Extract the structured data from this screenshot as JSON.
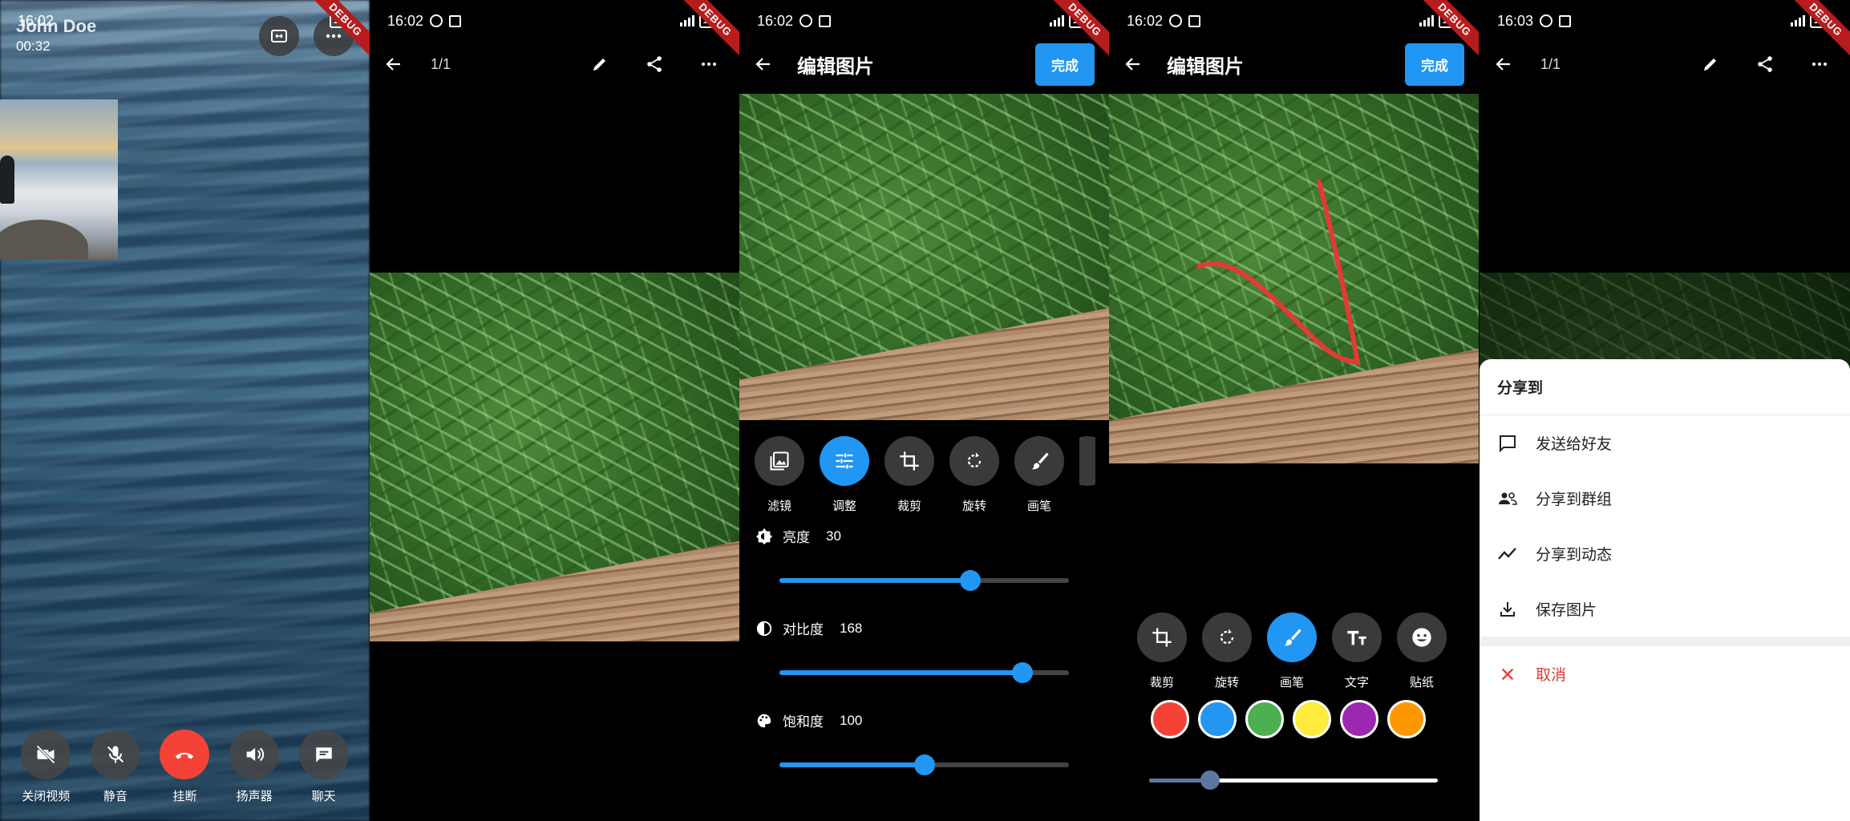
{
  "status": {
    "time_p1": "16:02",
    "time_p2": "16:02",
    "time_p3": "16:02",
    "time_p4": "16:02",
    "time_p5": "16:03",
    "battery": "100",
    "debug": "DEBUG"
  },
  "call": {
    "caller": "John Doe",
    "timer": "00:32",
    "controls": [
      {
        "label": "关闭视频",
        "icon": "videocam-off-icon"
      },
      {
        "label": "静音",
        "icon": "mic-off-icon"
      },
      {
        "label": "挂断",
        "icon": "hangup-icon"
      },
      {
        "label": "扬声器",
        "icon": "speaker-icon"
      },
      {
        "label": "聊天",
        "icon": "chat-icon"
      }
    ]
  },
  "viewer": {
    "pager": "1/1"
  },
  "editor": {
    "title": "编辑图片",
    "done": "完成",
    "tools": [
      {
        "label": "滤镜",
        "icon": "filter-icon"
      },
      {
        "label": "调整",
        "icon": "tune-icon"
      },
      {
        "label": "裁剪",
        "icon": "crop-icon"
      },
      {
        "label": "旋转",
        "icon": "rotate-icon"
      },
      {
        "label": "画笔",
        "icon": "brush-icon"
      }
    ],
    "adjustments": [
      {
        "label": "亮度",
        "value": "30",
        "level_pct": 66
      },
      {
        "label": "对比度",
        "value": "168",
        "level_pct": 84
      },
      {
        "label": "饱和度",
        "value": "100",
        "level_pct": 50
      }
    ]
  },
  "draw": {
    "title": "编辑图片",
    "done": "完成",
    "tools": [
      {
        "label": "裁剪",
        "icon": "crop-icon"
      },
      {
        "label": "旋转",
        "icon": "rotate-icon"
      },
      {
        "label": "画笔",
        "icon": "brush-icon"
      },
      {
        "label": "文字",
        "icon": "text-icon"
      },
      {
        "label": "贴纸",
        "icon": "sticker-icon"
      }
    ],
    "colors": [
      "#f44336",
      "#2196f3",
      "#4caf50",
      "#ffeb3b",
      "#9c27b0",
      "#ff9800"
    ],
    "brush_size_pct": 21
  },
  "share": {
    "pager": "1/1",
    "title": "分享到",
    "items": [
      {
        "label": "发送给好友",
        "icon": "chat-bubble-icon"
      },
      {
        "label": "分享到群组",
        "icon": "group-icon"
      },
      {
        "label": "分享到动态",
        "icon": "trending-icon"
      },
      {
        "label": "保存图片",
        "icon": "download-icon"
      }
    ],
    "cancel": "取消"
  }
}
